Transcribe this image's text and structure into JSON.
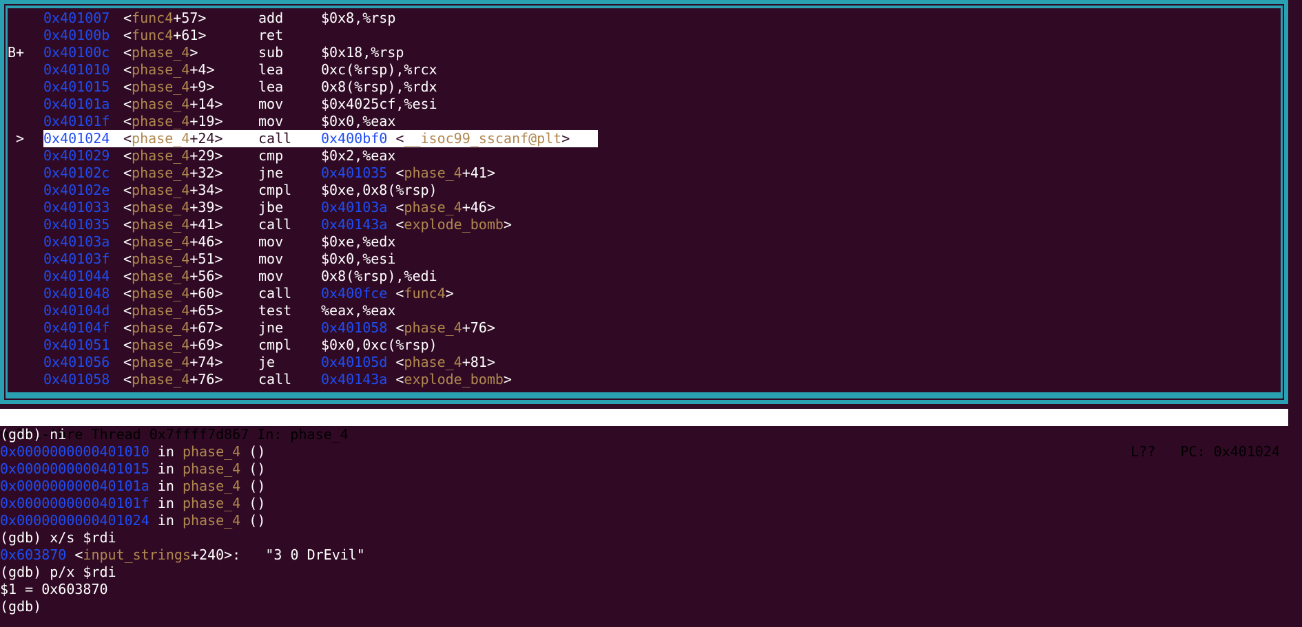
{
  "asm": {
    "lines": [
      {
        "marker": "",
        "addr": "0x401007",
        "fn": "func4",
        "off": "+57",
        "mnem": "add",
        "ops": "$0x8,%rsp"
      },
      {
        "marker": "",
        "addr": "0x40100b",
        "fn": "func4",
        "off": "+61",
        "mnem": "ret",
        "ops": ""
      },
      {
        "marker": "B+",
        "addr": "0x40100c",
        "fn": "phase_4",
        "off": "",
        "mnem": "sub",
        "ops": "$0x18,%rsp"
      },
      {
        "marker": "",
        "addr": "0x401010",
        "fn": "phase_4",
        "off": "+4",
        "mnem": "lea",
        "ops": "0xc(%rsp),%rcx"
      },
      {
        "marker": "",
        "addr": "0x401015",
        "fn": "phase_4",
        "off": "+9",
        "mnem": "lea",
        "ops": "0x8(%rsp),%rdx"
      },
      {
        "marker": "",
        "addr": "0x40101a",
        "fn": "phase_4",
        "off": "+14",
        "mnem": "mov",
        "ops": "$0x4025cf,%esi"
      },
      {
        "marker": "",
        "addr": "0x40101f",
        "fn": "phase_4",
        "off": "+19",
        "mnem": "mov",
        "ops": "$0x0,%eax"
      },
      {
        "marker": " >",
        "addr": "0x401024",
        "fn": "phase_4",
        "off": "+24",
        "mnem": "call",
        "target": "0x400bf0",
        "tsym": "__isoc99_sscanf@plt",
        "toff": "",
        "selected": true
      },
      {
        "marker": "",
        "addr": "0x401029",
        "fn": "phase_4",
        "off": "+29",
        "mnem": "cmp",
        "ops": "$0x2,%eax"
      },
      {
        "marker": "",
        "addr": "0x40102c",
        "fn": "phase_4",
        "off": "+32",
        "mnem": "jne",
        "target": "0x401035",
        "tsym": "phase_4",
        "toff": "+41"
      },
      {
        "marker": "",
        "addr": "0x40102e",
        "fn": "phase_4",
        "off": "+34",
        "mnem": "cmpl",
        "ops": "$0xe,0x8(%rsp)"
      },
      {
        "marker": "",
        "addr": "0x401033",
        "fn": "phase_4",
        "off": "+39",
        "mnem": "jbe",
        "target": "0x40103a",
        "tsym": "phase_4",
        "toff": "+46"
      },
      {
        "marker": "",
        "addr": "0x401035",
        "fn": "phase_4",
        "off": "+41",
        "mnem": "call",
        "target": "0x40143a",
        "tsym": "explode_bomb",
        "toff": ""
      },
      {
        "marker": "",
        "addr": "0x40103a",
        "fn": "phase_4",
        "off": "+46",
        "mnem": "mov",
        "ops": "$0xe,%edx"
      },
      {
        "marker": "",
        "addr": "0x40103f",
        "fn": "phase_4",
        "off": "+51",
        "mnem": "mov",
        "ops": "$0x0,%esi"
      },
      {
        "marker": "",
        "addr": "0x401044",
        "fn": "phase_4",
        "off": "+56",
        "mnem": "mov",
        "ops": "0x8(%rsp),%edi"
      },
      {
        "marker": "",
        "addr": "0x401048",
        "fn": "phase_4",
        "off": "+60",
        "mnem": "call",
        "target": "0x400fce",
        "tsym": "func4",
        "toff": ""
      },
      {
        "marker": "",
        "addr": "0x40104d",
        "fn": "phase_4",
        "off": "+65",
        "mnem": "test",
        "ops": "%eax,%eax"
      },
      {
        "marker": "",
        "addr": "0x40104f",
        "fn": "phase_4",
        "off": "+67",
        "mnem": "jne",
        "target": "0x401058",
        "tsym": "phase_4",
        "toff": "+76"
      },
      {
        "marker": "",
        "addr": "0x401051",
        "fn": "phase_4",
        "off": "+69",
        "mnem": "cmpl",
        "ops": "$0x0,0xc(%rsp)"
      },
      {
        "marker": "",
        "addr": "0x401056",
        "fn": "phase_4",
        "off": "+74",
        "mnem": "je",
        "target": "0x40105d",
        "tsym": "phase_4",
        "toff": "+81"
      },
      {
        "marker": "",
        "addr": "0x401058",
        "fn": "phase_4",
        "off": "+76",
        "mnem": "call",
        "target": "0x40143a",
        "tsym": "explode_bomb",
        "toff": ""
      }
    ]
  },
  "status": {
    "left": "multi-thre Thread 0x7ffff7d867 In: phase_4",
    "right": "L??   PC: 0x401024"
  },
  "console": {
    "prompt": "(gdb)",
    "lines": [
      {
        "type": "cmd",
        "text": "ni"
      },
      {
        "type": "frame",
        "addr": "0x0000000000401010",
        "in": "in",
        "fn": "phase_4",
        "tail": "()"
      },
      {
        "type": "frame",
        "addr": "0x0000000000401015",
        "in": "in",
        "fn": "phase_4",
        "tail": "()"
      },
      {
        "type": "frame",
        "addr": "0x000000000040101a",
        "in": "in",
        "fn": "phase_4",
        "tail": "()"
      },
      {
        "type": "frame",
        "addr": "0x000000000040101f",
        "in": "in",
        "fn": "phase_4",
        "tail": "()"
      },
      {
        "type": "frame",
        "addr": "0x0000000000401024",
        "in": "in",
        "fn": "phase_4",
        "tail": "()"
      },
      {
        "type": "cmd",
        "text": "x/s $rdi"
      },
      {
        "type": "mem",
        "addr": "0x603870",
        "sym": "input_strings",
        "off": "+240",
        "value": "\"3 0 DrEvil\""
      },
      {
        "type": "cmd",
        "text": "p/x $rdi"
      },
      {
        "type": "plain",
        "text": "$1 = 0x603870"
      },
      {
        "type": "cmd",
        "text": ""
      }
    ]
  },
  "colors": {
    "background": "#300a24",
    "frame": "#2aa1b3",
    "address": "#1f4cf2",
    "symbol": "#b08850",
    "text": "#ffffff"
  }
}
